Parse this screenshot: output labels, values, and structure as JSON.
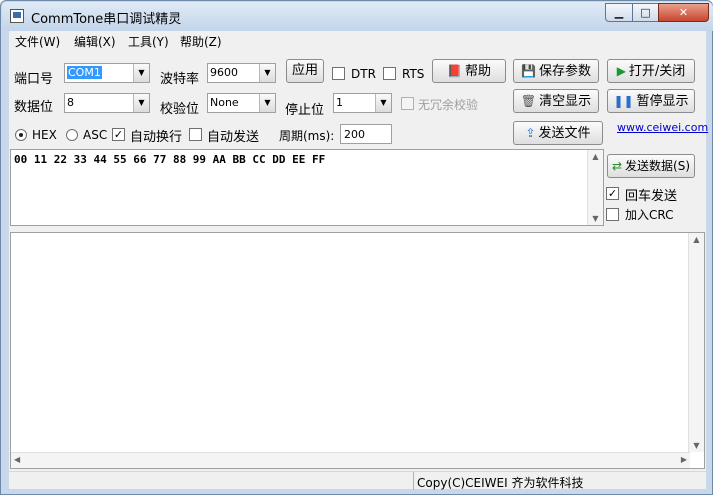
{
  "window": {
    "title": "CommTone串口调试精灵"
  },
  "menu": [
    "文件(W)",
    "编辑(X)",
    "工具(Y)",
    "帮助(Z)"
  ],
  "settings": {
    "port_label": "端口号",
    "port_value": "COM1",
    "baud_label": "波特率",
    "baud_value": "9600",
    "data_bits_label": "数据位",
    "data_bits_value": "8",
    "parity_label": "校验位",
    "parity_value": "None",
    "stop_bits_label": "停止位",
    "stop_bits_value": "1",
    "apply_label": "应用",
    "dtr_label": "DTR",
    "rts_label": "RTS",
    "no_redundant_label": "无冗余校验"
  },
  "buttons": {
    "help": "帮助",
    "save_params": "保存参数",
    "open_close": "打开/关闭",
    "clear_display": "清空显示",
    "pause_display": "暂停显示",
    "send_file": "发送文件",
    "send_data": "发送数据(S)"
  },
  "options": {
    "hex_label": "HEX",
    "asc_label": "ASC",
    "hex_selected": true,
    "auto_newline_label": "自动换行",
    "auto_newline_checked": true,
    "auto_send_label": "自动发送",
    "auto_send_checked": false,
    "period_label": "周期(ms):",
    "period_value": "200",
    "cr_send_label": "回车发送",
    "cr_send_checked": true,
    "crc_label": "加入CRC",
    "crc_checked": false
  },
  "link": "www.ceiwei.com",
  "send_text": "00 11 22 33 44 55 66 77 88 99 AA BB CC DD EE FF",
  "status": {
    "copyright": "Copy(C)CEIWEI 齐为软件科技"
  },
  "icons": {
    "help": "book-icon",
    "save": "floppy-disk-icon",
    "open": "play-icon",
    "clear": "trash-icon",
    "pause": "pause-icon",
    "send_file": "send-file-icon",
    "send_data": "send-data-icon"
  },
  "colors": {
    "selection": "#3399ff",
    "link": "#0000cc",
    "close_button": "#c7452e"
  }
}
